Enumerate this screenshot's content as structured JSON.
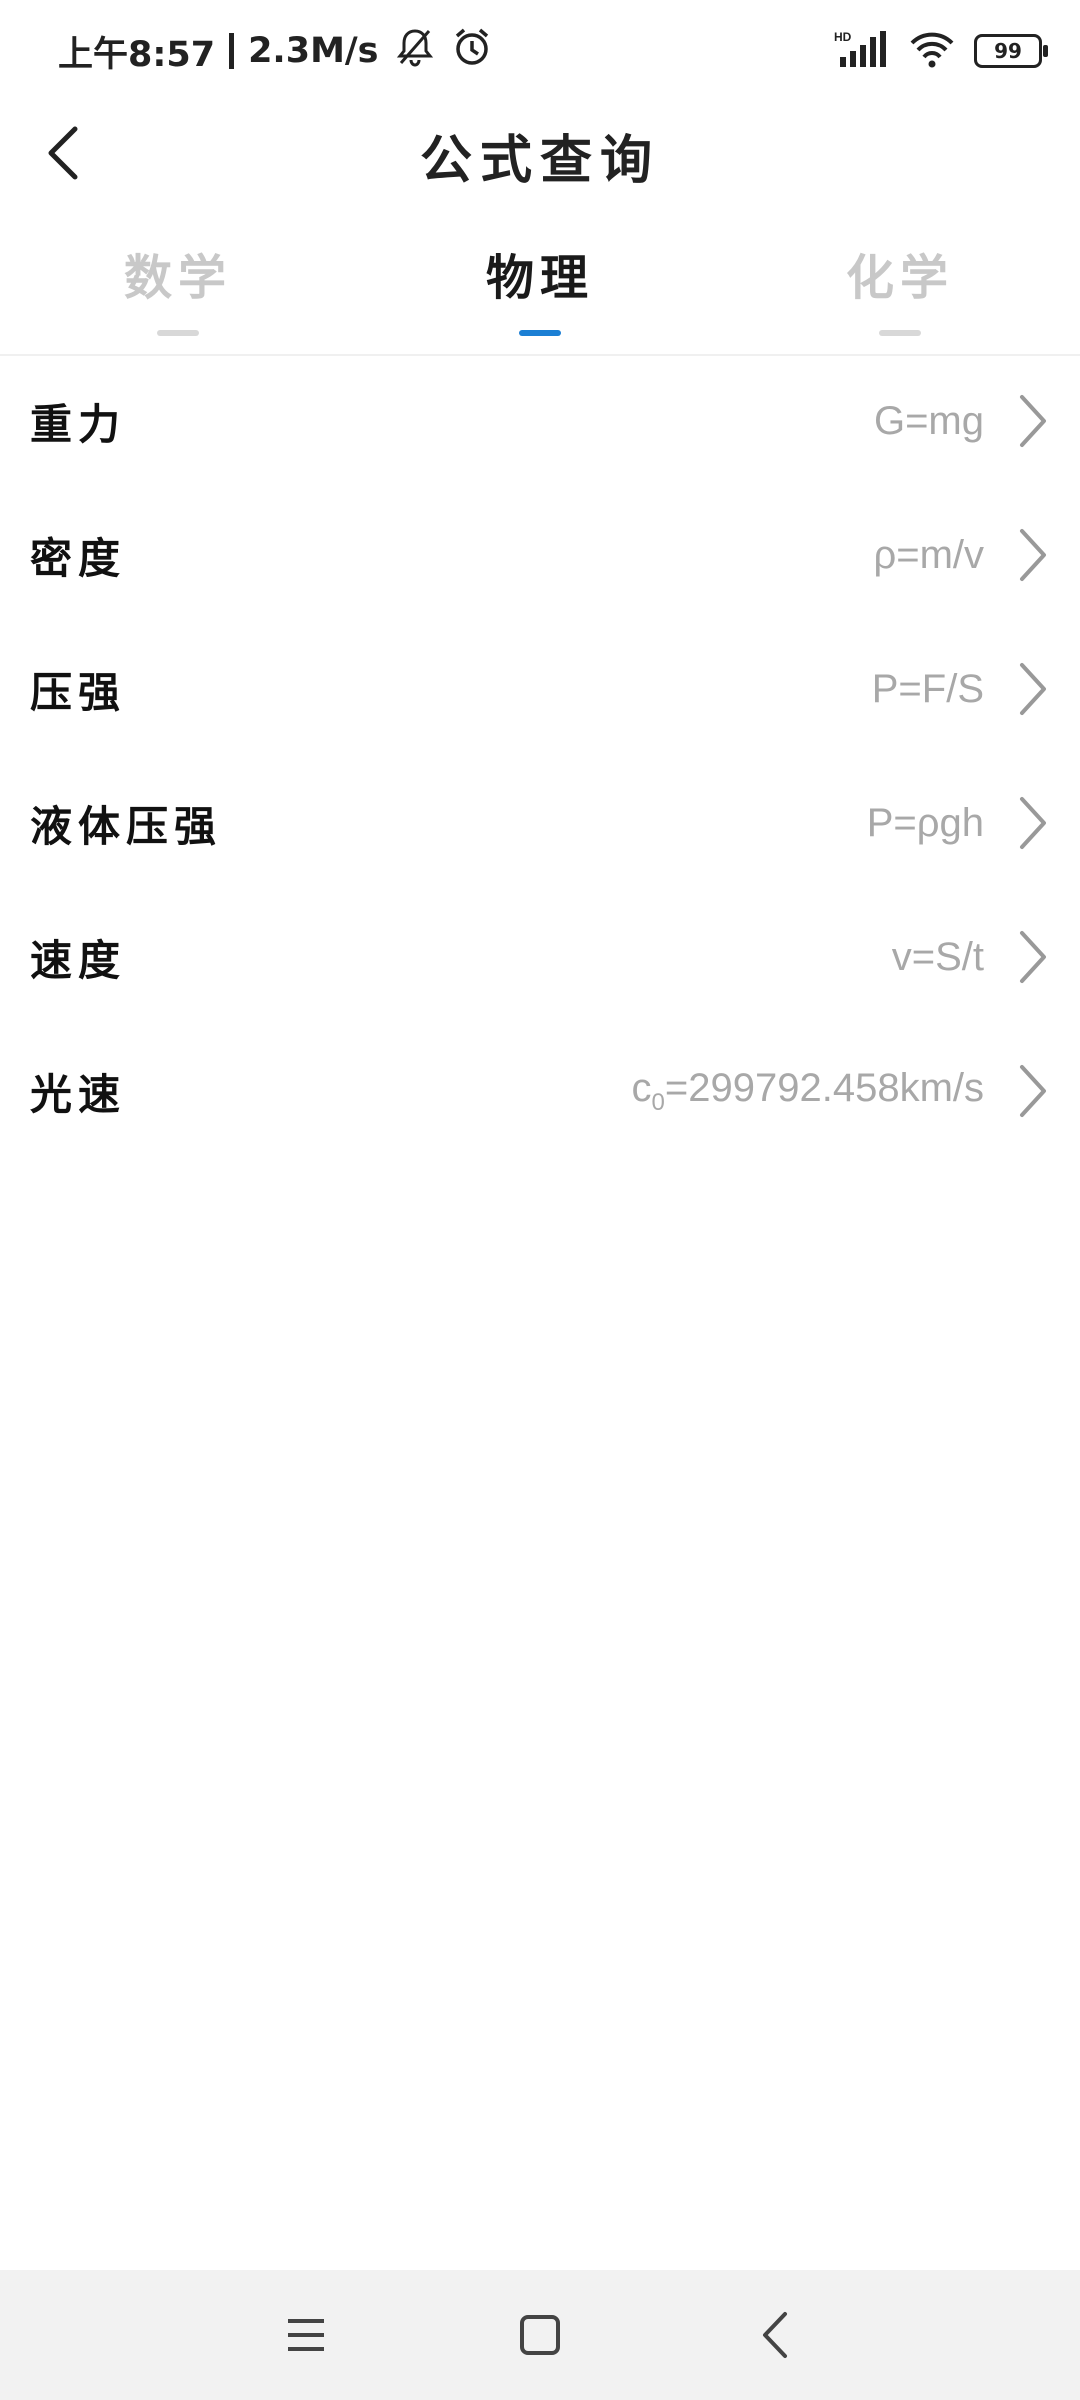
{
  "status_bar": {
    "time": "上午8:57",
    "speed": "2.3M/s",
    "battery": "99",
    "icons": [
      "bell-muted-icon",
      "alarm-icon",
      "signal-icon",
      "wifi-icon",
      "battery-icon"
    ]
  },
  "header": {
    "title": "公式查询"
  },
  "tabs": [
    {
      "label": "数学",
      "active": false
    },
    {
      "label": "物理",
      "active": true
    },
    {
      "label": "化学",
      "active": false
    }
  ],
  "formulas": [
    {
      "name": "重力",
      "formula": "G=mg"
    },
    {
      "name": "密度",
      "formula": "ρ=m/v"
    },
    {
      "name": "压强",
      "formula": "P=F/S"
    },
    {
      "name": "液体压强",
      "formula": "P=ρgh"
    },
    {
      "name": "速度",
      "formula": "v=S/t"
    },
    {
      "name": "光速",
      "formula_prefix": "c",
      "formula_sub": "0",
      "formula_rest": "=299792.458km/s"
    }
  ],
  "colors": {
    "accent": "#1b7fd4",
    "inactive_tab": "#c8c8c8",
    "formula_text": "#a8a8a8",
    "nav_bg": "#f2f2f2"
  }
}
